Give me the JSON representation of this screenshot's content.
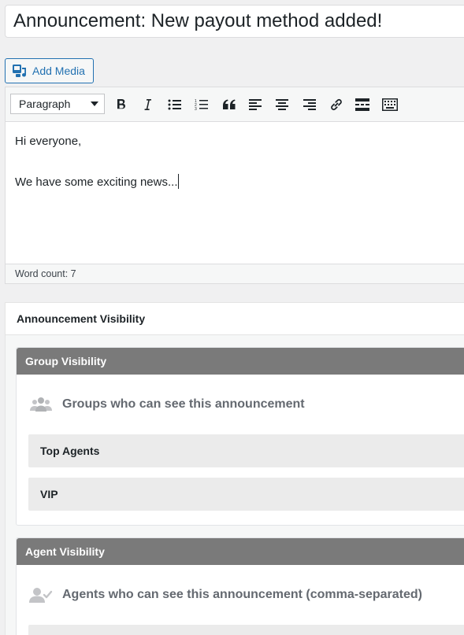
{
  "title": {
    "value": "Announcement: New payout method added!"
  },
  "add_media": {
    "label": "Add Media"
  },
  "toolbar": {
    "format": "Paragraph",
    "buttons": [
      "bold",
      "italic",
      "bulleted-list",
      "numbered-list",
      "blockquote",
      "align-left",
      "align-center",
      "align-right",
      "insert-link",
      "read-more",
      "toolbar-toggle"
    ]
  },
  "editor": {
    "paragraphs": [
      "Hi everyone,",
      "We have some exciting news..."
    ],
    "word_count": "Word count: 7"
  },
  "visibility": {
    "title": "Announcement Visibility",
    "group": {
      "header": "Group Visibility",
      "subtitle": "Groups who can see this announcement",
      "items": [
        "Top Agents",
        "VIP"
      ]
    },
    "agent": {
      "header": "Agent Visibility",
      "subtitle": "Agents who can see this announcement (comma-separated)",
      "value": ""
    }
  },
  "colors": {
    "accent": "#2271b1",
    "panel_header": "#7a7a7a",
    "chip_bg": "#ebebeb",
    "page_bg": "#f0f0f1"
  }
}
